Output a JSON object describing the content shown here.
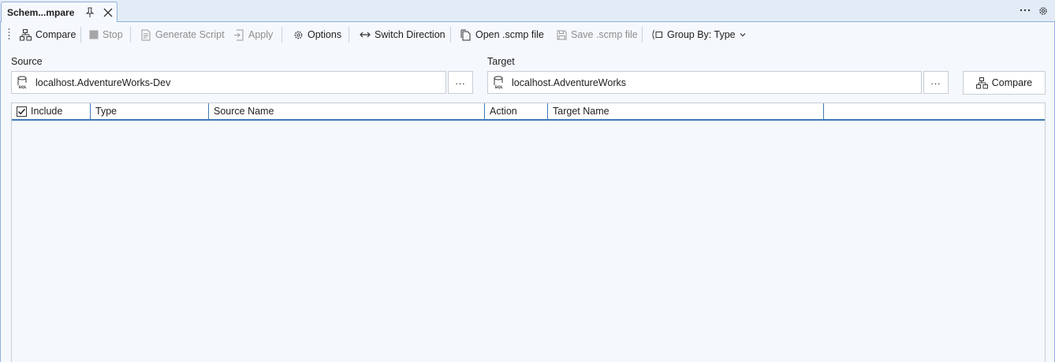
{
  "tab": {
    "title": "Schem...mpare"
  },
  "toolbar": {
    "compare_label": "Compare",
    "stop_label": "Stop",
    "generate_script_label": "Generate Script",
    "apply_label": "Apply",
    "options_label": "Options",
    "switch_direction_label": "Switch Direction",
    "open_scmp_label": "Open .scmp file",
    "save_scmp_label": "Save .scmp file",
    "group_by_label": "Group By: Type"
  },
  "source": {
    "label": "Source",
    "value": "localhost.AdventureWorks-Dev",
    "browse_label": "..."
  },
  "target": {
    "label": "Target",
    "value": "localhost.AdventureWorks",
    "browse_label": "..."
  },
  "compare_button_label": "Compare",
  "grid": {
    "columns": [
      "Include",
      "Type",
      "Source Name",
      "Action",
      "Target Name"
    ],
    "include_checked": true,
    "rows": []
  },
  "colors": {
    "accent": "#3d7ab8",
    "panel": "#f5f8fc",
    "border": "#8fb2dc"
  },
  "icons": [
    "pin-icon",
    "close-icon",
    "more-icon",
    "gear-icon",
    "compare-icon",
    "stop-icon",
    "generate-script-icon",
    "apply-icon",
    "options-icon",
    "switch-direction-icon",
    "open-file-icon",
    "save-file-icon",
    "group-by-icon",
    "database-icon"
  ]
}
